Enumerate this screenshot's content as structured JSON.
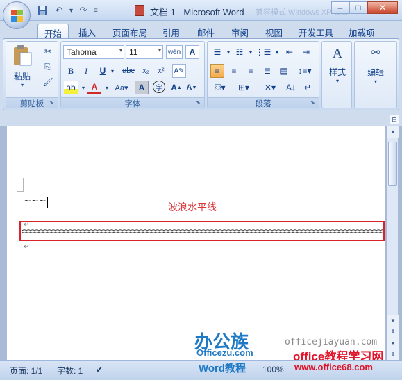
{
  "window": {
    "title": "文档 1 - Microsoft Word",
    "ghost_text": "兼容模式 Windows XP 设置"
  },
  "quick_access": {
    "save": "save-icon",
    "undo": "undo-icon",
    "redo": "redo-icon"
  },
  "tabs": [
    "开始",
    "插入",
    "页面布局",
    "引用",
    "邮件",
    "审阅",
    "视图",
    "开发工具",
    "加载项"
  ],
  "ribbon": {
    "clipboard": {
      "label": "剪贴板",
      "paste": "粘贴"
    },
    "font": {
      "label": "字体",
      "name": "Tahoma",
      "size": "11",
      "wen": "wén",
      "A": "A"
    },
    "paragraph": {
      "label": "段落"
    },
    "styles": {
      "label": "样式"
    },
    "editing": {
      "label": "编辑"
    }
  },
  "document": {
    "tilde_text": "~~~",
    "caption": "波浪水平线",
    "para_mark": "↵"
  },
  "status": {
    "page": "页面: 1/1",
    "words": "字数: 1",
    "zoom": "100%"
  },
  "watermarks": {
    "logo": "办公族",
    "logo_url": "Officezu.com",
    "word_tutorial": "Word教程",
    "jiayuan": "officejiayuan.com",
    "learn": "office教程学习网",
    "office68": "www.office68.com"
  },
  "colors": {
    "accent": "#15428b",
    "wave_box": "#d8232a",
    "caption": "#d9363a"
  }
}
